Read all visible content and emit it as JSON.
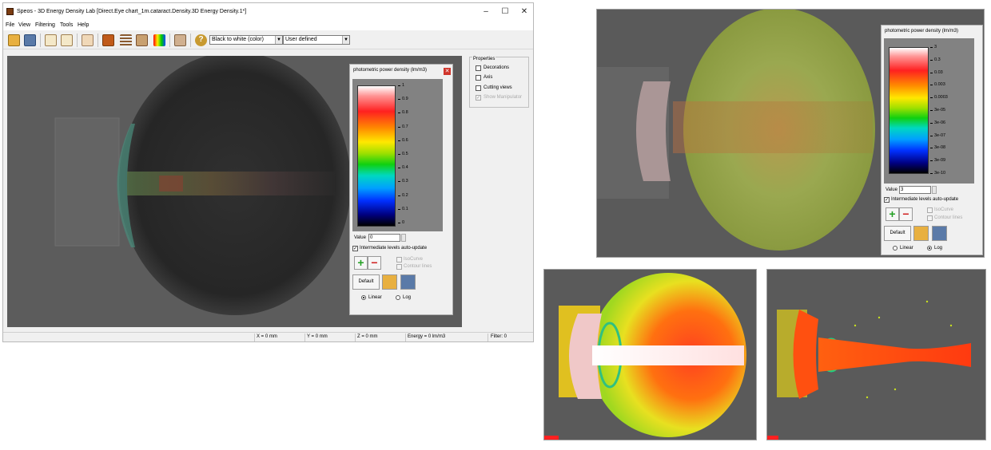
{
  "window": {
    "title": "Speos - 3D Energy Density Lab [Direct.Eye chart_1m.cataract.Density.3D Energy Density.1*]",
    "minimize": "–",
    "maximize": "☐",
    "close": "✕"
  },
  "menu": [
    "File",
    "View",
    "Filtering",
    "Tools",
    "Help"
  ],
  "toolbar": {
    "colormap_select": "Black to white (color)",
    "scale_select": "User defined"
  },
  "properties": {
    "legend": "Properties",
    "items": [
      {
        "label": "Decorations",
        "checked": false,
        "enabled": true
      },
      {
        "label": "Axis",
        "checked": false,
        "enabled": true
      },
      {
        "label": "Cutting views",
        "checked": false,
        "enabled": true
      },
      {
        "label": "Show Manipulator",
        "checked": true,
        "enabled": false
      }
    ]
  },
  "statusbar": {
    "x": "X = 0 mm",
    "y": "Y = 0 mm",
    "z": "Z = 0 mm",
    "energy": "Energy = 0 lm/m3",
    "filter": "Filter: 0"
  },
  "panel_linear": {
    "title": "photometric power density (lm/m3)",
    "ticks": [
      "1",
      "0.9",
      "0.8",
      "0.7",
      "0.6",
      "0.5",
      "0.4",
      "0.3",
      "0.2",
      "0.1",
      "0"
    ],
    "value_label": "Value",
    "value": "0",
    "auto_update_label": "Intermediate levels auto-update",
    "isocurve_label": "IsoCurve",
    "contour_label": "Contour lines",
    "default_label": "Default",
    "linear_label": "Linear",
    "log_label": "Log",
    "scale": "Linear"
  },
  "panel_log": {
    "title": "photometric power density (lm/m3)",
    "ticks": [
      "3",
      "0.3",
      "0.03",
      "0.003",
      "0.0003",
      "3e-05",
      "3e-06",
      "3e-07",
      "3e-08",
      "3e-09",
      "3e-10"
    ],
    "value_label": "Value",
    "value": "3",
    "auto_update_label": "Intermediate levels auto-update",
    "isocurve_label": "IsoCurve",
    "contour_label": "Contour lines",
    "default_label": "Default",
    "linear_label": "Linear",
    "log_label": "Log",
    "scale": "Log"
  },
  "colors": {
    "viewport_bg": "#5c5c5c",
    "close_red": "#d0352b",
    "plus_green": "#22a022",
    "minus_red": "#d02020"
  }
}
